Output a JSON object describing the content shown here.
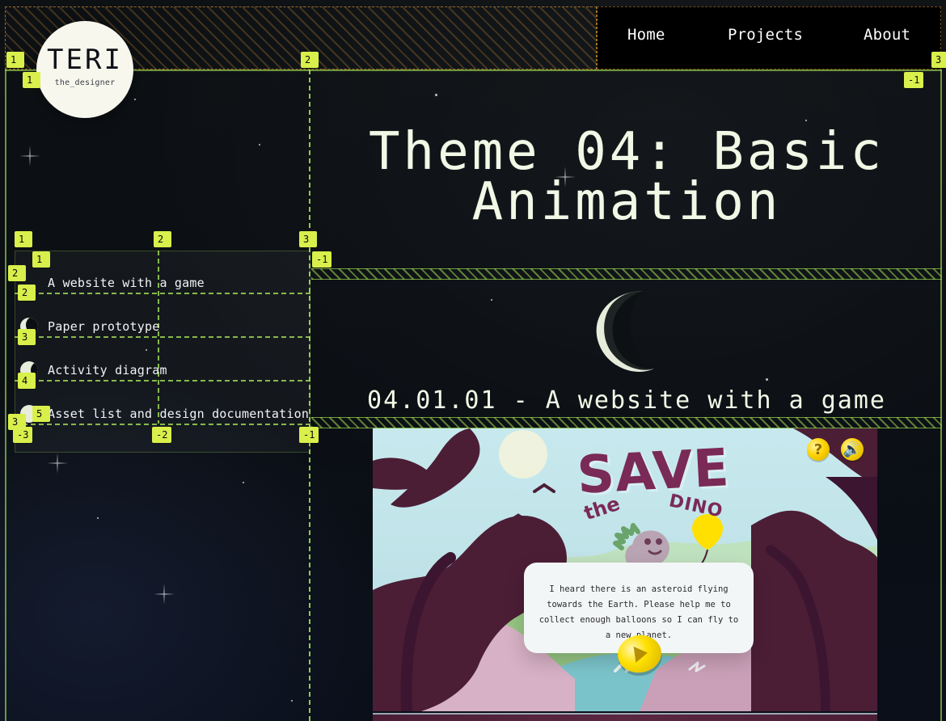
{
  "nav": {
    "items": [
      {
        "label": "Home"
      },
      {
        "label": "Projects"
      },
      {
        "label": "About"
      }
    ]
  },
  "logo": {
    "main": "TERI",
    "sub": "the_designer"
  },
  "page": {
    "title": "Theme 04: Basic Animation",
    "section_heading": "04.01.01 - A website with a game"
  },
  "sidebar": {
    "items": [
      {
        "label": "A website with a game",
        "icon": "new-moon-icon"
      },
      {
        "label": "Paper prototype",
        "icon": "crescent-moon-icon"
      },
      {
        "label": "Activity diagram",
        "icon": "gibbous-moon-icon"
      },
      {
        "label": "Asset list and design documentation",
        "icon": "full-moon-icon"
      }
    ]
  },
  "game": {
    "title": "SAVE",
    "subtitle_the": "the",
    "subtitle_dino": "DINO",
    "text": "I heard there is an asteroid flying towards the Earth. Please help me to collect enough balloons so I can fly to a new planet.",
    "icons": [
      {
        "name": "help-icon",
        "glyph": "?"
      },
      {
        "name": "sound-icon",
        "glyph": "🔊"
      }
    ]
  },
  "devtools_grid": {
    "badges": [
      "1",
      "2",
      "3",
      "1",
      "-1",
      "1",
      "2",
      "3",
      "1",
      "-1",
      "2",
      "2",
      "3",
      "4",
      "5",
      "3",
      "-3",
      "-2",
      "-1"
    ]
  },
  "colors": {
    "background": "#0b0f14",
    "text": "#f3f8e6",
    "grid": "#a0dc50",
    "badge": "#d9ef4b",
    "orange_hatch": "#ffaa3c",
    "game_primary": "#7a2a56",
    "game_sky": "#c2e4ea"
  }
}
